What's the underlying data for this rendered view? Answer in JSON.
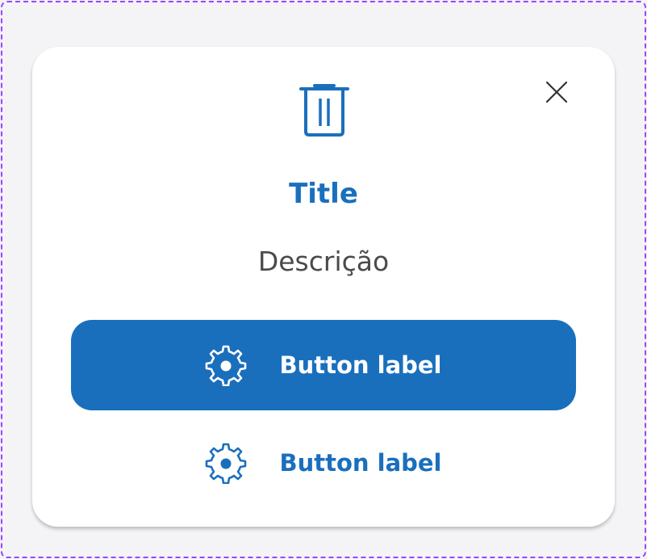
{
  "dialog": {
    "title": "Title",
    "description": "Descrição",
    "icon": "trash-icon",
    "close_icon": "close-icon"
  },
  "buttons": {
    "primary": {
      "label": "Button label",
      "icon": "gear-icon"
    },
    "secondary": {
      "label": "Button label",
      "icon": "gear-icon"
    }
  },
  "colors": {
    "accent": "#1a6fbd",
    "text": "#4a4a4a",
    "frame": "#9747ff"
  }
}
